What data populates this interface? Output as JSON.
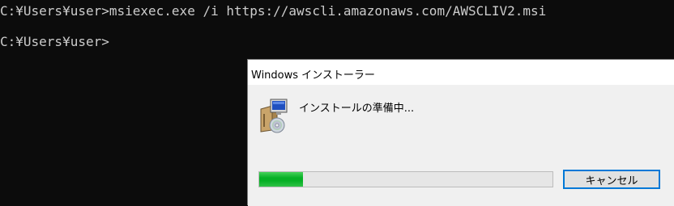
{
  "console": {
    "background": "#0c0c0c",
    "text_color": "#cccccc",
    "lines": [
      "C:¥Users¥user>msiexec.exe /i https://awscli.amazonaws.com/AWSCLIV2.msi",
      "C:¥Users¥user>"
    ]
  },
  "installer": {
    "title": "Windows インストーラー",
    "status_text": "インストールの準備中...",
    "icon": "installer-package-icon",
    "progress": 0.15,
    "progress_color": "#06b025",
    "cancel_label": "キャンセル",
    "accent": "#0078d7"
  }
}
